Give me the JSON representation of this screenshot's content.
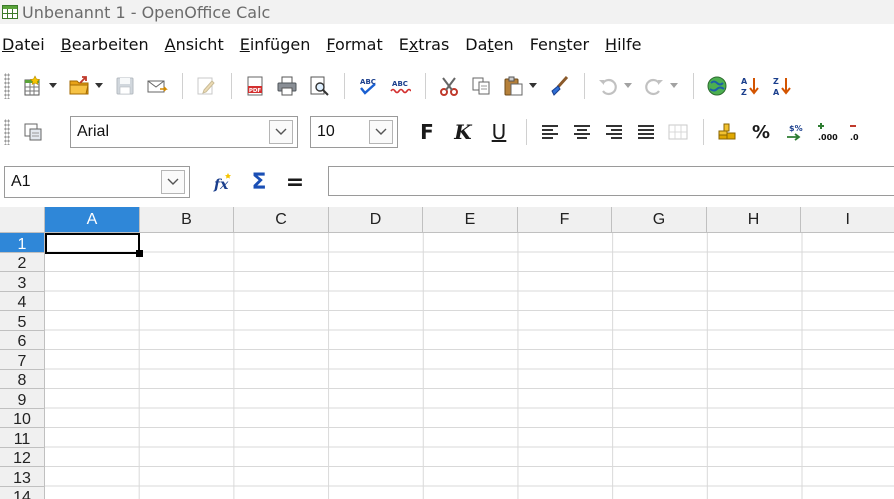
{
  "window": {
    "title": "Unbenannt 1 - OpenOffice Calc"
  },
  "menu": [
    {
      "acc": "D",
      "rest": "atei"
    },
    {
      "acc": "B",
      "rest": "earbeiten"
    },
    {
      "acc": "A",
      "rest": "nsicht"
    },
    {
      "acc": "E",
      "rest": "infügen"
    },
    {
      "acc": "F",
      "rest": "ormat"
    },
    {
      "pre": "E",
      "acc": "x",
      "rest": "tras"
    },
    {
      "pre": "Da",
      "acc": "t",
      "rest": "en"
    },
    {
      "pre": "Fen",
      "acc": "s",
      "rest": "ter"
    },
    {
      "acc": "H",
      "rest": "ilfe"
    }
  ],
  "formatting": {
    "font_name": "Arial",
    "font_size": "10",
    "bold_label": "F",
    "italic_label": "K",
    "underline_label": "U",
    "percent_label": "%"
  },
  "formula_bar": {
    "name_box": "A1",
    "function_wizard_label": "fx",
    "sum_label": "Σ",
    "equals_label": "="
  },
  "sheet": {
    "columns": [
      "A",
      "B",
      "C",
      "D",
      "E",
      "F",
      "G",
      "H",
      "I"
    ],
    "rows": [
      "1",
      "2",
      "3",
      "4",
      "5",
      "6",
      "7",
      "8",
      "9",
      "10",
      "11",
      "12",
      "13",
      "14"
    ],
    "active_cell": "A1",
    "accent_color": "#2f87d8"
  }
}
